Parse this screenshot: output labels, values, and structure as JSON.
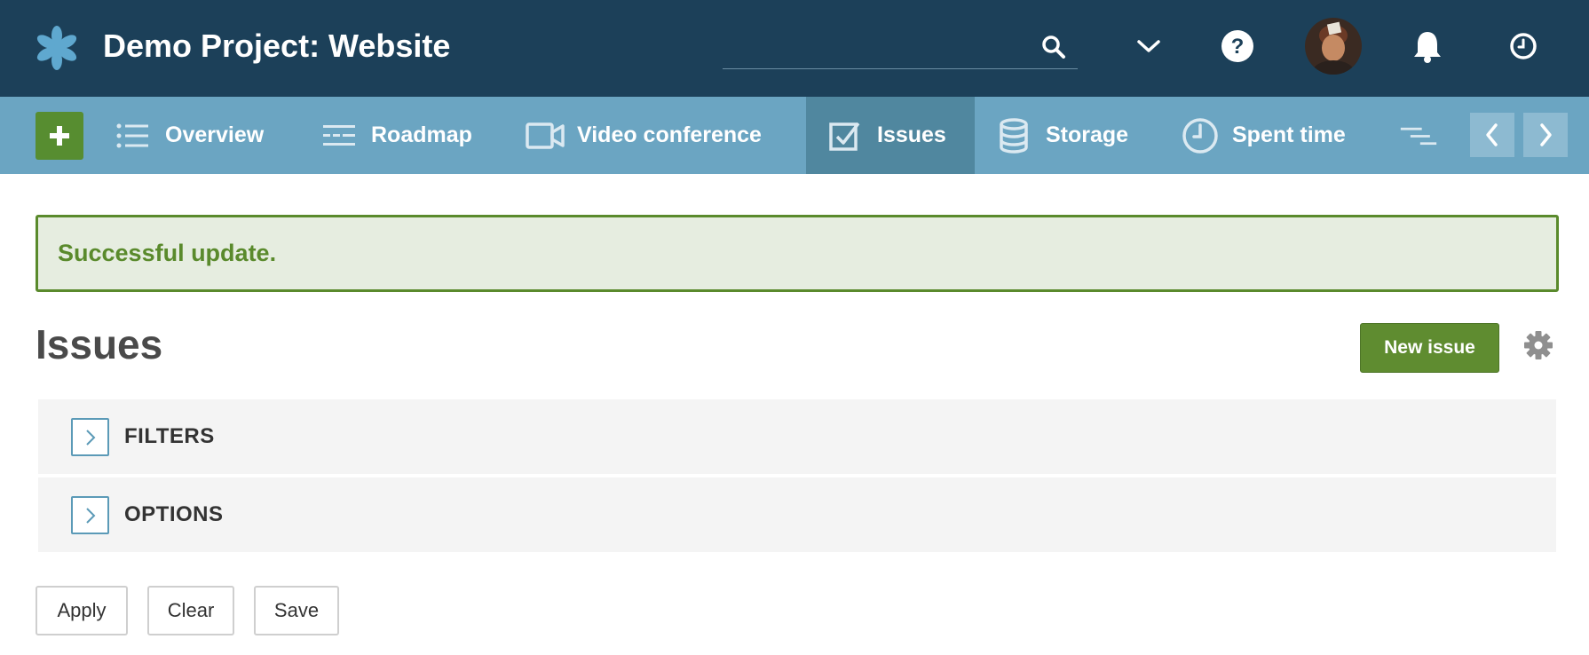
{
  "header": {
    "project_title": "Demo Project: Website",
    "search": {
      "value": "",
      "placeholder": ""
    }
  },
  "nav": {
    "items": [
      {
        "label": "Overview",
        "icon": "list-icon"
      },
      {
        "label": "Roadmap",
        "icon": "roadmap-icon"
      },
      {
        "label": "Video conference",
        "icon": "video-icon"
      },
      {
        "label": "Issues",
        "icon": "checkbox-icon",
        "active": true
      },
      {
        "label": "Storage",
        "icon": "database-icon"
      },
      {
        "label": "Spent time",
        "icon": "clock-icon"
      }
    ]
  },
  "flash": {
    "message": "Successful update."
  },
  "main": {
    "title": "Issues",
    "new_issue_label": "New issue",
    "sections": [
      {
        "label": "FILTERS"
      },
      {
        "label": "OPTIONS"
      }
    ],
    "buttons": {
      "apply": "Apply",
      "clear": "Clear",
      "save": "Save"
    }
  },
  "colors": {
    "header_bg": "#1c4059",
    "nav_bg": "#6ba5c2",
    "nav_active_bg": "#50879f",
    "success": "#5a8a2c",
    "success_bg": "#e6ede0"
  }
}
